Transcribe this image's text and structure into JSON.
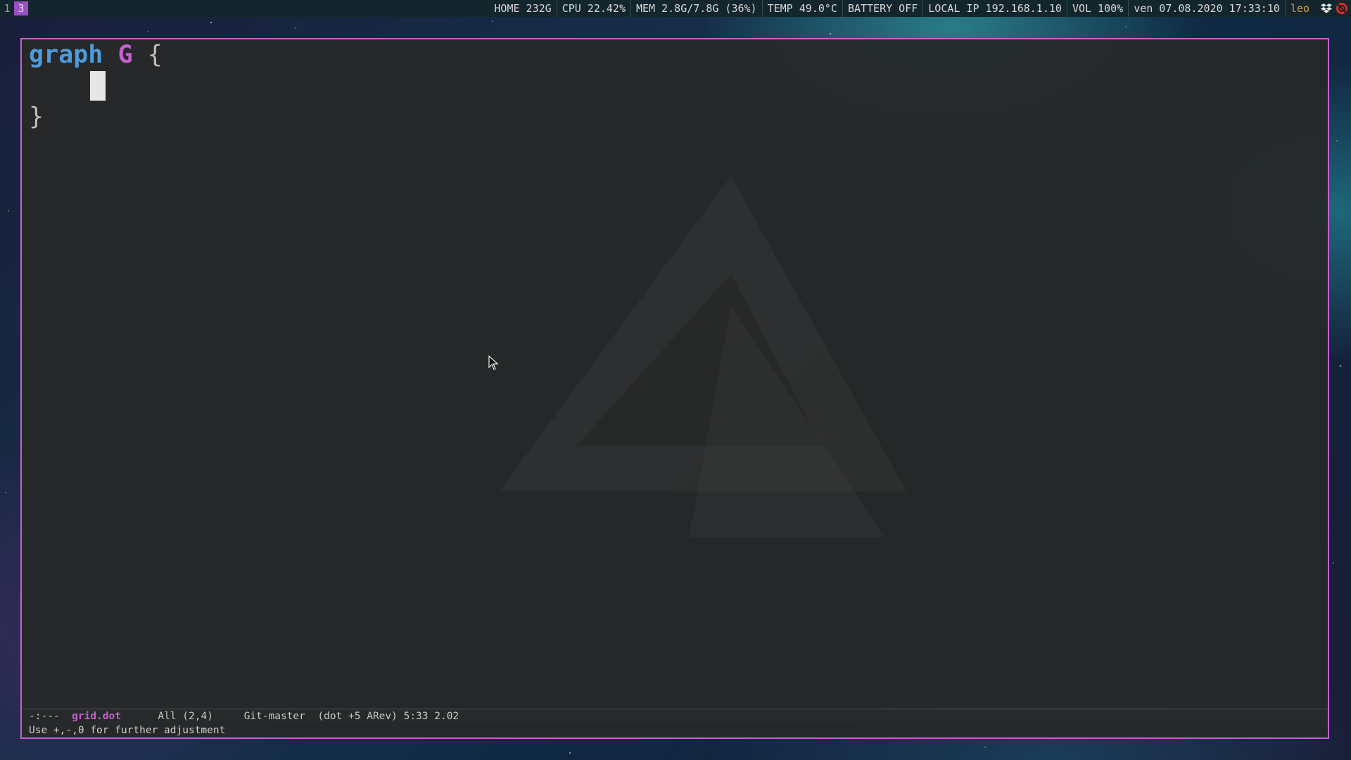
{
  "workspaces": [
    {
      "label": "1",
      "active": false
    },
    {
      "label": "3",
      "active": true
    }
  ],
  "status": {
    "home": "HOME 232G",
    "cpu": "CPU 22.42%",
    "mem": "MEM 2.8G/7.8G (36%)",
    "temp": "TEMP 49.0°C",
    "battery": "BATTERY OFF",
    "ip": "LOCAL IP 192.168.1.10",
    "vol": "VOL 100%",
    "datetime": "ven 07.08.2020 17:33:10",
    "user": "leo"
  },
  "tray": {
    "icons": [
      "dropbox-icon",
      "notification-icon"
    ]
  },
  "editor": {
    "line1": {
      "keyword": "graph",
      "id": "G",
      "brace": "{"
    },
    "line3": {
      "brace": "}"
    }
  },
  "modeline": {
    "flags": "-:---",
    "buffer": "grid.dot",
    "position": "All (2,4)",
    "vc": "Git-master",
    "modes": "(dot +5 ARev) 5:33 2.02"
  },
  "minibuffer": {
    "message": "Use +,-,0 for further adjustment"
  },
  "colors": {
    "frame_border": "#c661d6",
    "keyword": "#4f9ad9",
    "identifier": "#c75fd1",
    "workspace_active": "#9b4fc4",
    "user": "#d9a24a"
  }
}
